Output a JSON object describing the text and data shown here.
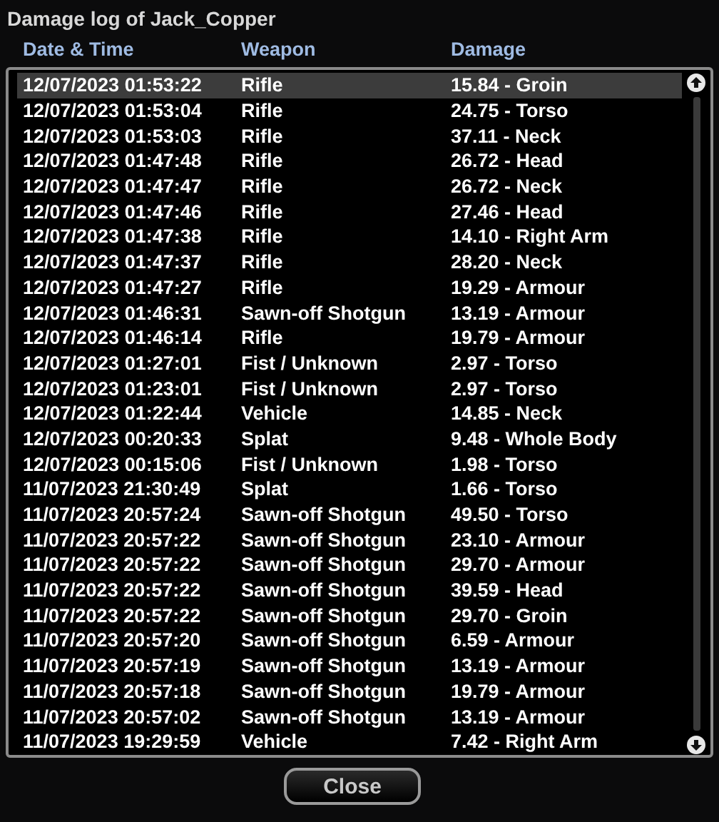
{
  "window": {
    "title": "Damage log of Jack_Copper"
  },
  "table": {
    "columns": [
      "Date & Time",
      "Weapon",
      "Damage"
    ],
    "rows": [
      {
        "cells": [
          "12/07/2023 01:53:22",
          "Rifle",
          "15.84 - Groin"
        ],
        "selected": true
      },
      {
        "cells": [
          "12/07/2023 01:53:04",
          "Rifle",
          "24.75 - Torso"
        ],
        "selected": false
      },
      {
        "cells": [
          "12/07/2023 01:53:03",
          "Rifle",
          "37.11 - Neck"
        ],
        "selected": false
      },
      {
        "cells": [
          "12/07/2023 01:47:48",
          "Rifle",
          "26.72 - Head"
        ],
        "selected": false
      },
      {
        "cells": [
          "12/07/2023 01:47:47",
          "Rifle",
          "26.72 - Neck"
        ],
        "selected": false
      },
      {
        "cells": [
          "12/07/2023 01:47:46",
          "Rifle",
          "27.46 - Head"
        ],
        "selected": false
      },
      {
        "cells": [
          "12/07/2023 01:47:38",
          "Rifle",
          "14.10 - Right Arm"
        ],
        "selected": false
      },
      {
        "cells": [
          "12/07/2023 01:47:37",
          "Rifle",
          "28.20 - Neck"
        ],
        "selected": false
      },
      {
        "cells": [
          "12/07/2023 01:47:27",
          "Rifle",
          "19.29 - Armour"
        ],
        "selected": false
      },
      {
        "cells": [
          "12/07/2023 01:46:31",
          "Sawn-off Shotgun",
          "13.19 - Armour"
        ],
        "selected": false
      },
      {
        "cells": [
          "12/07/2023 01:46:14",
          "Rifle",
          "19.79 - Armour"
        ],
        "selected": false
      },
      {
        "cells": [
          "12/07/2023 01:27:01",
          "Fist / Unknown",
          "2.97 - Torso"
        ],
        "selected": false
      },
      {
        "cells": [
          "12/07/2023 01:23:01",
          "Fist / Unknown",
          "2.97 - Torso"
        ],
        "selected": false
      },
      {
        "cells": [
          "12/07/2023 01:22:44",
          "Vehicle",
          "14.85 - Neck"
        ],
        "selected": false
      },
      {
        "cells": [
          "12/07/2023 00:20:33",
          "Splat",
          "9.48 - Whole Body"
        ],
        "selected": false
      },
      {
        "cells": [
          "12/07/2023 00:15:06",
          "Fist / Unknown",
          "1.98 - Torso"
        ],
        "selected": false
      },
      {
        "cells": [
          "11/07/2023 21:30:49",
          "Splat",
          "1.66 - Torso"
        ],
        "selected": false
      },
      {
        "cells": [
          "11/07/2023 20:57:24",
          "Sawn-off Shotgun",
          "49.50 - Torso"
        ],
        "selected": false
      },
      {
        "cells": [
          "11/07/2023 20:57:22",
          "Sawn-off Shotgun",
          "23.10 - Armour"
        ],
        "selected": false
      },
      {
        "cells": [
          "11/07/2023 20:57:22",
          "Sawn-off Shotgun",
          "29.70 - Armour"
        ],
        "selected": false
      },
      {
        "cells": [
          "11/07/2023 20:57:22",
          "Sawn-off Shotgun",
          "39.59 - Head"
        ],
        "selected": false
      },
      {
        "cells": [
          "11/07/2023 20:57:22",
          "Sawn-off Shotgun",
          "29.70 - Groin"
        ],
        "selected": false
      },
      {
        "cells": [
          "11/07/2023 20:57:20",
          "Sawn-off Shotgun",
          "6.59 - Armour"
        ],
        "selected": false
      },
      {
        "cells": [
          "11/07/2023 20:57:19",
          "Sawn-off Shotgun",
          "13.19 - Armour"
        ],
        "selected": false
      },
      {
        "cells": [
          "11/07/2023 20:57:18",
          "Sawn-off Shotgun",
          "19.79 - Armour"
        ],
        "selected": false
      },
      {
        "cells": [
          "11/07/2023 20:57:02",
          "Sawn-off Shotgun",
          "13.19 - Armour"
        ],
        "selected": false
      },
      {
        "cells": [
          "11/07/2023 19:29:59",
          "Vehicle",
          "7.42 - Right Arm"
        ],
        "selected": false
      }
    ]
  },
  "buttons": [
    "Close"
  ]
}
